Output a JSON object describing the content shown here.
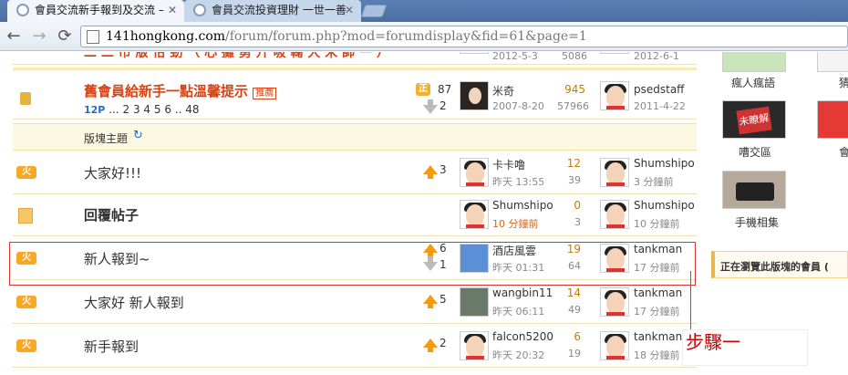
{
  "browser": {
    "tabs": [
      {
        "title": "會員交流新手報到及交流 –"
      },
      {
        "title": "會員交流投資理財 一世一善"
      }
    ],
    "url_host": "141hongkong.com",
    "url_path": "/forum/forum.php?mod=forumdisplay&fid=61&page=1"
  },
  "forum": {
    "top_partial": {
      "date1": "2012-5-3",
      "views": "5086",
      "date2": "2012-6-1"
    },
    "pinned": {
      "title": "舊會員給新手一點溫馨提示",
      "badge": "推薦",
      "pages_prefix": "12P",
      "pages": [
        "...",
        "2",
        "3",
        "4",
        "5",
        "6",
        "..",
        "48"
      ],
      "votes_up": "87",
      "votes_down": "2",
      "author": "米奇",
      "author_date": "2007-8-20",
      "replies": "945",
      "views": "57966",
      "last_user": "psedstaff",
      "last_date": "2011-4-22"
    },
    "section_header": "版塊主題",
    "threads": [
      {
        "title": "大家好!!!",
        "up": "3",
        "down": "",
        "author": "卡卡噜",
        "author_date": "昨天 13:55",
        "replies": "12",
        "views": "39",
        "last_user": "Shumshipo",
        "last_date": "3 分鐘前"
      },
      {
        "title": "回覆帖子",
        "up": "",
        "down": "",
        "author": "Shumshipo",
        "author_date": "10 分鐘前",
        "replies": "0",
        "views": "3",
        "last_user": "Shumshipo",
        "last_date": "10 分鐘前"
      },
      {
        "title": "新人報到~",
        "up": "6",
        "down": "1",
        "author": "酒店風雲",
        "author_date": "昨天 01:31",
        "replies": "19",
        "views": "64",
        "last_user": "tankman",
        "last_date": "17 分鐘前"
      },
      {
        "title": "大家好 新人報到",
        "up": "5",
        "down": "",
        "author": "wangbin11",
        "author_date": "昨天 06:11",
        "replies": "14",
        "views": "49",
        "last_user": "tankman",
        "last_date": "17 分鐘前"
      },
      {
        "title": "新手報到",
        "up": "2",
        "down": "",
        "author": "falcon5200",
        "author_date": "昨天 20:32",
        "replies": "6",
        "views": "19",
        "last_user": "tankman",
        "last_date": "18 分鐘前"
      }
    ]
  },
  "sidebar": {
    "items": [
      {
        "caption": "瘋人瘋語"
      },
      {
        "caption": "猜"
      },
      {
        "caption": "嘈交區"
      },
      {
        "caption": "會"
      },
      {
        "caption": "手機相集"
      }
    ],
    "online_title": "正在瀏覽此版塊的會員 ("
  },
  "annotation": {
    "step_label": "步驟一"
  },
  "colors": {
    "accent_red": "#c62828",
    "thread_title_red": "#d84315",
    "rep_orange": "#c67b00"
  }
}
